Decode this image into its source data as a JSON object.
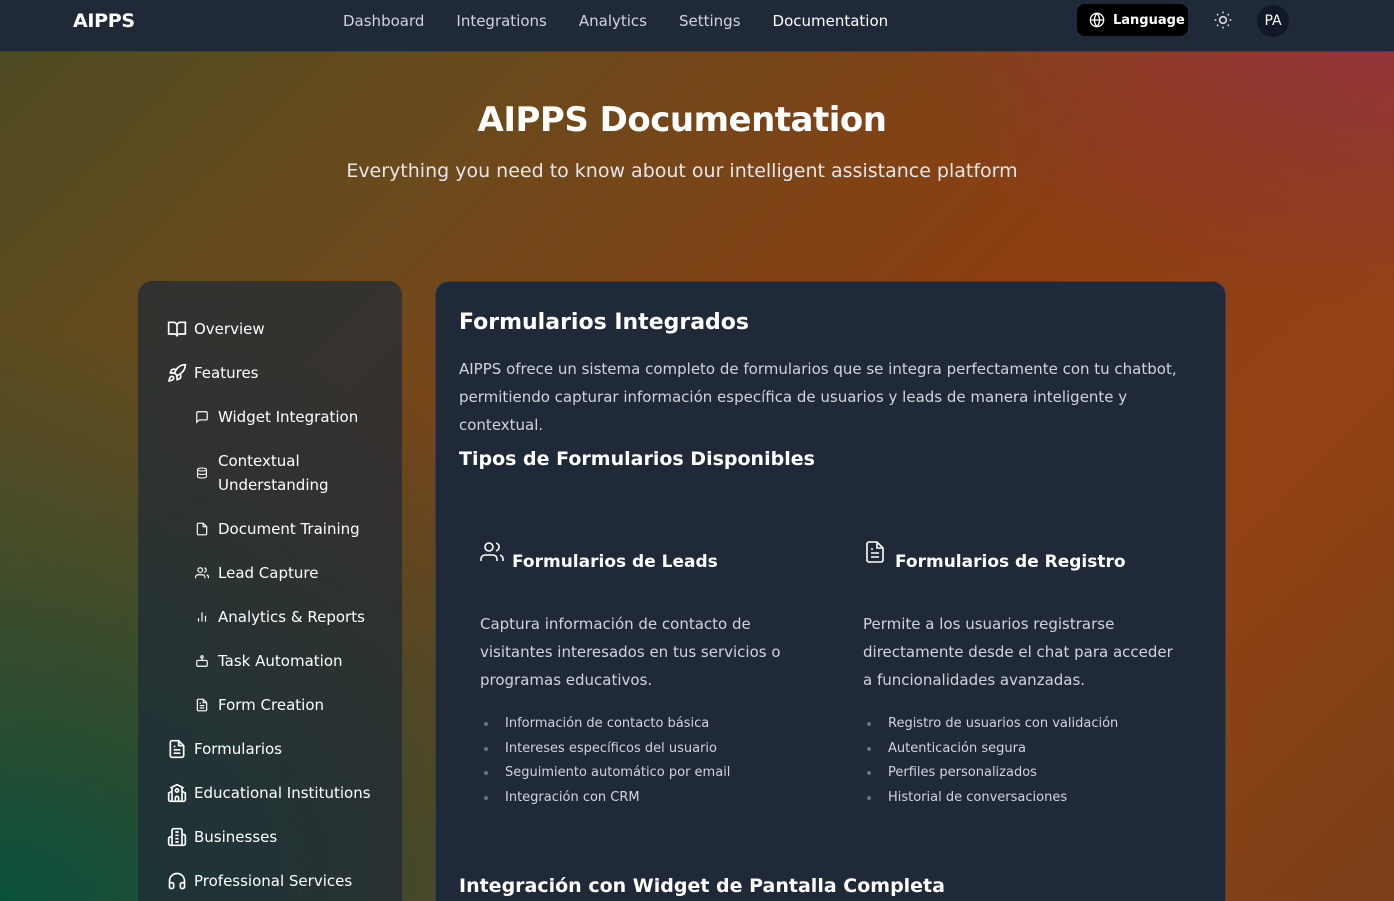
{
  "header": {
    "logo": "AIPPS",
    "nav": [
      "Dashboard",
      "Integrations",
      "Analytics",
      "Settings",
      "Documentation"
    ],
    "active_nav": "Documentation",
    "language_label": "Language",
    "avatar_initials": "PA"
  },
  "hero": {
    "title": "AIPPS Documentation",
    "subtitle": "Everything you need to know about our intelligent assistance platform"
  },
  "sidebar": {
    "items": [
      {
        "label": "Overview",
        "icon": "book-open-icon"
      },
      {
        "label": "Features",
        "icon": "rocket-icon"
      },
      {
        "label": "Widget Integration",
        "icon": "message-square-icon"
      },
      {
        "label": "Contextual Understanding",
        "icon": "database-icon"
      },
      {
        "label": "Document Training",
        "icon": "file-icon"
      },
      {
        "label": "Lead Capture",
        "icon": "users-icon"
      },
      {
        "label": "Analytics & Reports",
        "icon": "bar-chart-icon"
      },
      {
        "label": "Task Automation",
        "icon": "bot-icon"
      },
      {
        "label": "Form Creation",
        "icon": "file-text-icon"
      },
      {
        "label": "Formularios",
        "icon": "file-text-icon"
      },
      {
        "label": "Educational Institutions",
        "icon": "school-icon"
      },
      {
        "label": "Businesses",
        "icon": "building-icon"
      },
      {
        "label": "Professional Services",
        "icon": "headphones-icon"
      }
    ]
  },
  "content": {
    "title": "Formularios Integrados",
    "intro": "AIPPS ofrece un sistema completo de formularios que se integra perfectamente con tu chatbot, permitiendo capturar información específica de usuarios y leads de manera inteligente y contextual.",
    "types_heading": "Tipos de Formularios Disponibles",
    "cards": [
      {
        "title": "Formularios de Leads",
        "icon": "users-icon",
        "description": "Captura información de contacto de visitantes interesados en tus servicios o programas educativos.",
        "bullets": [
          "Información de contacto básica",
          "Intereses específicos del usuario",
          "Seguimiento automático por email",
          "Integración con CRM"
        ]
      },
      {
        "title": "Formularios de Registro",
        "icon": "file-text-icon",
        "description": "Permite a los usuarios registrarse directamente desde el chat para acceder a funcionalidades avanzadas.",
        "bullets": [
          "Registro de usuarios con validación",
          "Autenticación segura",
          "Perfiles personalizados",
          "Historial de conversaciones"
        ]
      }
    ],
    "next_heading": "Integración con Widget de Pantalla Completa"
  }
}
